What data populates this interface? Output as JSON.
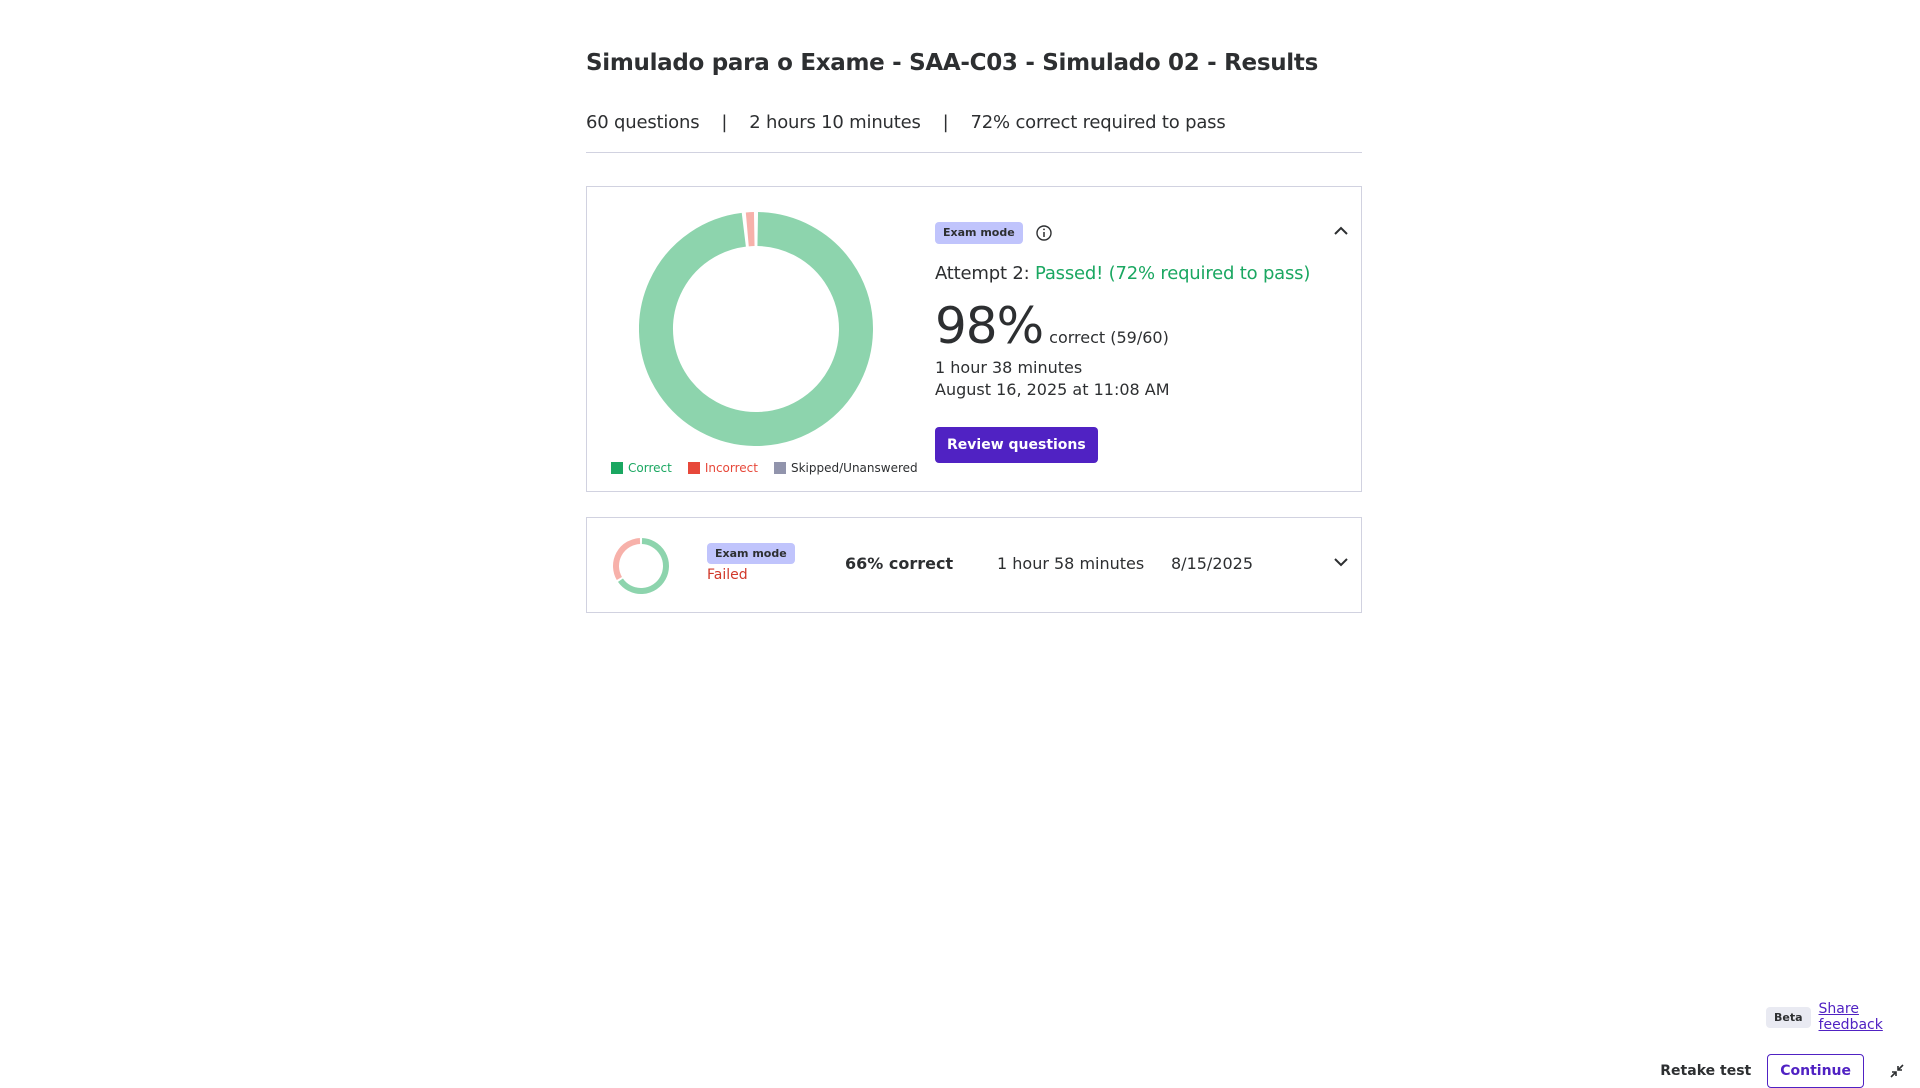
{
  "header": {
    "title": "Simulado para o Exame - SAA-C03 - Simulado 02 - Results",
    "questions": "60 questions",
    "separator": "|",
    "duration": "2 hours 10 minutes",
    "pass_requirement": "72% correct required to pass"
  },
  "latest_attempt": {
    "mode_badge": "Exam mode",
    "info_icon": "info-icon",
    "attempt_label": "Attempt 2:",
    "result_text": "Passed! (72% required to pass)",
    "score_percent": "98%",
    "score_detail": "correct (59/60)",
    "duration": "1 hour 38 minutes",
    "datetime": "August 16, 2025 at 11:08 AM",
    "review_button": "Review questions",
    "collapse_icon": "chevron-up-icon",
    "chart": {
      "type": "donut",
      "correct": 59,
      "incorrect": 1,
      "skipped": 0
    },
    "legend": {
      "correct": "Correct",
      "incorrect": "Incorrect",
      "skipped": "Skipped/Unanswered"
    }
  },
  "previous_attempt": {
    "mode_badge": "Exam mode",
    "status": "Failed",
    "score": "66% correct",
    "duration": "1 hour 58 minutes",
    "date": "8/15/2025",
    "expand_icon": "chevron-down-icon",
    "chart": {
      "type": "donut",
      "correct_fraction": 0.66,
      "incorrect_fraction": 0.34
    }
  },
  "feedback": {
    "beta_badge": "Beta",
    "share_link": "Share feedback"
  },
  "footer": {
    "retake_label": "Retake test",
    "continue_label": "Continue",
    "exit_icon": "collapse-icon"
  },
  "colors": {
    "correct": "#8dd4ad",
    "incorrect": "#f7b1aa",
    "skipped": "#9194ac",
    "correct_legend": "#1aa761",
    "incorrect_legend": "#e7483a",
    "skipped_legend": "#9194ac",
    "accent": "#5022c3",
    "badge": "#c0c4fc"
  }
}
